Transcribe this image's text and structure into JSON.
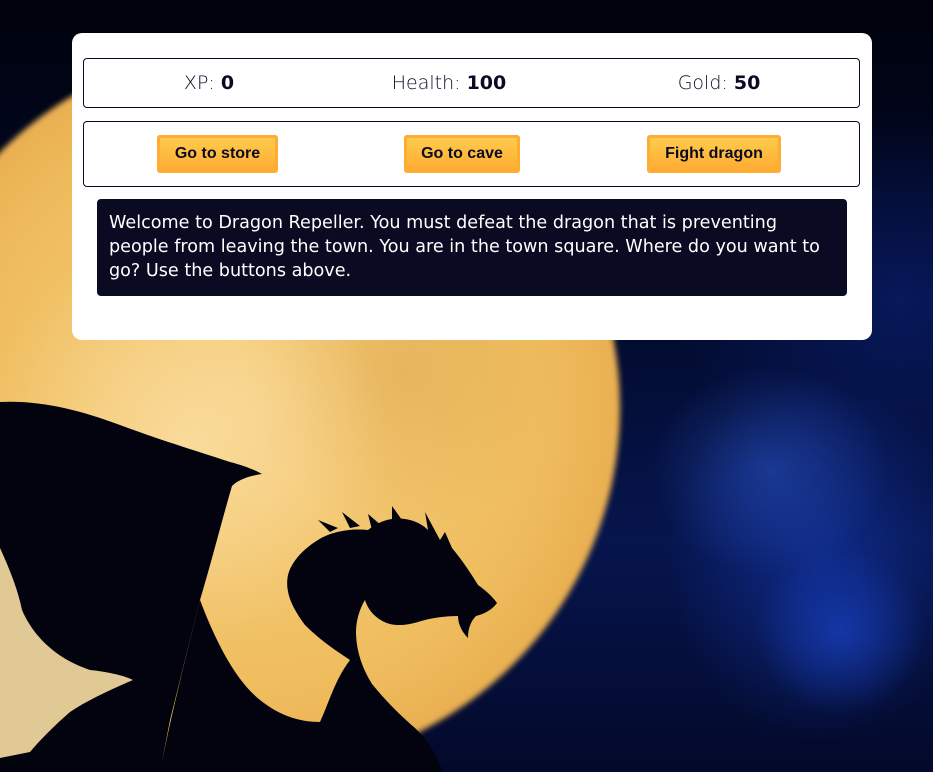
{
  "stats": {
    "xp_label": "XP:",
    "xp_value": "0",
    "health_label": "Health:",
    "health_value": "100",
    "gold_label": "Gold:",
    "gold_value": "50"
  },
  "controls": {
    "button1": "Go to store",
    "button2": "Go to cave",
    "button3": "Fight dragon"
  },
  "text": "Welcome to Dragon Repeller. You must defeat the dragon that is preventing people from leaving the town. You are in the town square. Where do you want to go? Use the buttons above.",
  "colors": {
    "card_background": "#ffffff",
    "text_box_background": "#0a0a23",
    "button_gradient_top": "#fecc4c",
    "button_gradient_bottom": "#ffac33",
    "moon": "#efbd5e",
    "sky": "#06154d"
  },
  "background": {
    "moon": "full-moon",
    "silhouette": "dragon-silhouette"
  }
}
